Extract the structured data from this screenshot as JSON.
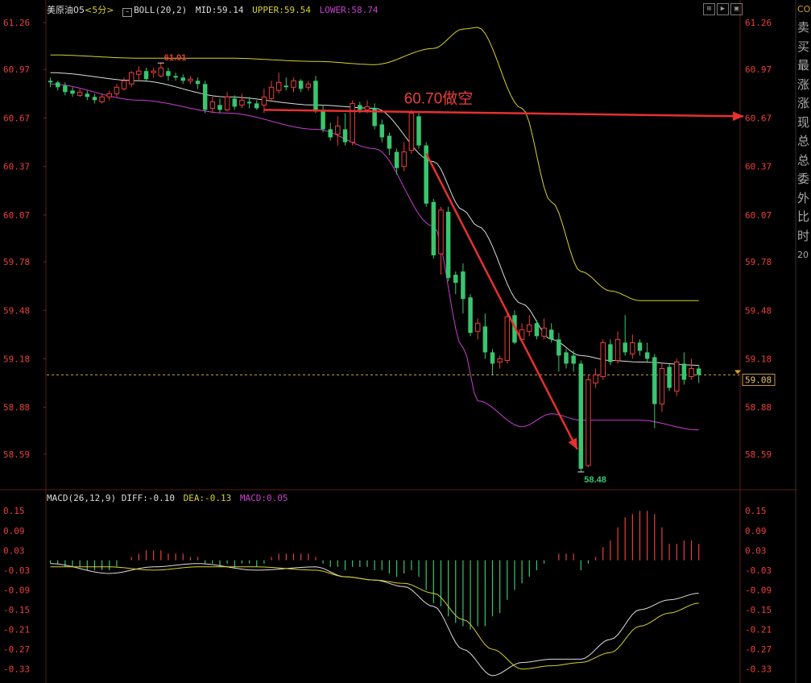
{
  "header": {
    "symbol": "美原油05",
    "period": "<5分>",
    "boll_label": "BOLL(20,2)",
    "mid_label": "MID:",
    "mid_value": "59.14",
    "upper_label": "UPPER:",
    "upper_value": "59.54",
    "lower_label": "LOWER:",
    "lower_value": "58.74"
  },
  "macd_header": {
    "label": "MACD(26,12,9)",
    "diff_label": "DIFF:",
    "diff_value": "-0.10",
    "dea_label": "DEA:",
    "dea_value": "-0.13",
    "macd_label": "MACD:",
    "macd_value": "0.05"
  },
  "side_panel": [
    "CO",
    "卖",
    "买",
    "最",
    "涨",
    "涨",
    "现",
    "总",
    "总",
    "委",
    "外",
    "比",
    "时",
    "20"
  ],
  "annotation_text": "60.70做空",
  "colors": {
    "up": "#e8403a",
    "down": "#39c66f",
    "mid": "#dddddd",
    "upper": "#d9d12c",
    "lower": "#c93fd2",
    "dea": "#d9d12c",
    "arrow": "#e83030",
    "axis_text": "#e8403a",
    "current_line": "#c89a3c"
  },
  "chart_data": [
    {
      "type": "candlestick",
      "title": "美原油05 <5分> BOLL(20,2)",
      "ylim": [
        58.42,
        61.3
      ],
      "y_ticks": [
        "61.26",
        "60.97",
        "60.67",
        "60.37",
        "60.07",
        "59.78",
        "59.48",
        "59.18",
        "58.88",
        "58.59"
      ],
      "y_tick_values": [
        61.26,
        60.97,
        60.67,
        60.37,
        60.07,
        59.78,
        59.48,
        59.18,
        58.88,
        58.59
      ],
      "current_price": 59.08,
      "current_price_label": "59.08",
      "high_label": "61.01",
      "high_value": 61.01,
      "low_label": "58.48",
      "low_value": 58.48,
      "bar_count": 84,
      "candles": [
        [
          0,
          60.9,
          60.89,
          60.92,
          60.86
        ],
        [
          1,
          60.89,
          60.86,
          60.9,
          60.84
        ],
        [
          2,
          60.87,
          60.83,
          60.89,
          60.81
        ],
        [
          3,
          60.84,
          60.82,
          60.86,
          60.8
        ],
        [
          4,
          60.81,
          60.83,
          60.85,
          60.8
        ],
        [
          5,
          60.82,
          60.8,
          60.84,
          60.78
        ],
        [
          6,
          60.8,
          60.78,
          60.82,
          60.76
        ],
        [
          7,
          60.77,
          60.8,
          60.82,
          60.76
        ],
        [
          8,
          60.8,
          60.82,
          60.84,
          60.78
        ],
        [
          9,
          60.82,
          60.86,
          60.88,
          60.8
        ],
        [
          10,
          60.85,
          60.9,
          60.92,
          60.84
        ],
        [
          11,
          60.88,
          60.95,
          60.96,
          60.86
        ],
        [
          12,
          60.94,
          60.96,
          60.99,
          60.9
        ],
        [
          13,
          60.96,
          60.91,
          60.98,
          60.9
        ],
        [
          14,
          60.95,
          60.96,
          60.98,
          60.92
        ],
        [
          15,
          60.93,
          60.98,
          61.01,
          60.92
        ],
        [
          16,
          60.96,
          60.93,
          60.98,
          60.9
        ],
        [
          17,
          60.93,
          60.92,
          60.95,
          60.9
        ],
        [
          18,
          60.92,
          60.9,
          60.94,
          60.88
        ],
        [
          19,
          60.9,
          60.91,
          60.93,
          60.88
        ],
        [
          20,
          60.9,
          60.88,
          60.92,
          60.85
        ],
        [
          21,
          60.88,
          60.72,
          60.9,
          60.7
        ],
        [
          22,
          60.73,
          60.77,
          60.8,
          60.7
        ],
        [
          23,
          60.75,
          60.72,
          60.79,
          60.7
        ],
        [
          24,
          60.72,
          60.8,
          60.83,
          60.71
        ],
        [
          25,
          60.79,
          60.74,
          60.81,
          60.72
        ],
        [
          26,
          60.75,
          60.78,
          60.82,
          60.73
        ],
        [
          27,
          60.77,
          60.76,
          60.8,
          60.73
        ],
        [
          28,
          60.76,
          60.73,
          60.78,
          60.72
        ],
        [
          29,
          60.75,
          60.8,
          60.85,
          60.7
        ],
        [
          30,
          60.79,
          60.86,
          60.9,
          60.78
        ],
        [
          31,
          60.84,
          60.89,
          60.95,
          60.82
        ],
        [
          32,
          60.87,
          60.86,
          60.92,
          60.84
        ],
        [
          33,
          60.86,
          60.9,
          60.92,
          60.83
        ],
        [
          34,
          60.9,
          60.85,
          60.91,
          60.83
        ],
        [
          35,
          60.86,
          60.88,
          60.9,
          60.84
        ],
        [
          36,
          60.9,
          60.72,
          60.93,
          60.7
        ],
        [
          37,
          60.72,
          60.6,
          60.75,
          60.58
        ],
        [
          38,
          60.6,
          60.55,
          60.64,
          60.53
        ],
        [
          39,
          60.57,
          60.62,
          60.68,
          60.5
        ],
        [
          40,
          60.6,
          60.52,
          60.7,
          60.5
        ],
        [
          41,
          60.52,
          60.76,
          60.78,
          60.5
        ],
        [
          42,
          60.75,
          60.72,
          60.77,
          60.7
        ],
        [
          43,
          60.72,
          60.74,
          60.78,
          60.7
        ],
        [
          44,
          60.73,
          60.62,
          60.76,
          60.6
        ],
        [
          45,
          60.63,
          60.55,
          60.66,
          60.52
        ],
        [
          46,
          60.56,
          60.48,
          60.58,
          60.44
        ],
        [
          47,
          60.46,
          60.36,
          60.48,
          60.32
        ],
        [
          48,
          60.37,
          60.46,
          60.52,
          60.34
        ],
        [
          49,
          60.47,
          60.7,
          60.72,
          60.45
        ],
        [
          50,
          60.68,
          60.5,
          60.7,
          60.48
        ],
        [
          51,
          60.5,
          60.14,
          60.52,
          60.12
        ],
        [
          52,
          60.15,
          59.82,
          60.17,
          59.8
        ],
        [
          53,
          59.83,
          60.1,
          60.12,
          59.7
        ],
        [
          54,
          60.09,
          59.68,
          60.12,
          59.66
        ],
        [
          55,
          59.7,
          59.65,
          59.72,
          59.58
        ],
        [
          56,
          59.72,
          59.55,
          59.77,
          59.46
        ],
        [
          57,
          59.56,
          59.34,
          59.58,
          59.32
        ],
        [
          58,
          59.35,
          59.4,
          59.43,
          59.3
        ],
        [
          59,
          59.38,
          59.22,
          59.46,
          59.18
        ],
        [
          60,
          59.22,
          59.15,
          59.24,
          59.08
        ],
        [
          61,
          59.16,
          59.18,
          59.2,
          59.12
        ],
        [
          62,
          59.17,
          59.44,
          59.47,
          59.15
        ],
        [
          63,
          59.45,
          59.28,
          59.48,
          59.27
        ],
        [
          64,
          59.3,
          59.36,
          59.4,
          59.28
        ],
        [
          65,
          59.35,
          59.39,
          59.45,
          59.32
        ],
        [
          66,
          59.4,
          59.32,
          59.42,
          59.3
        ],
        [
          67,
          59.32,
          59.37,
          59.43,
          59.3
        ],
        [
          68,
          59.36,
          59.3,
          59.4,
          59.28
        ],
        [
          69,
          59.3,
          59.2,
          59.34,
          59.1
        ],
        [
          70,
          59.22,
          59.15,
          59.24,
          59.12
        ],
        [
          71,
          59.2,
          59.15,
          59.23,
          59.1
        ],
        [
          72,
          59.15,
          58.5,
          59.17,
          58.48
        ],
        [
          73,
          58.52,
          59.05,
          59.08,
          58.51
        ],
        [
          74,
          59.03,
          59.08,
          59.12,
          59.0
        ],
        [
          75,
          59.07,
          59.28,
          59.3,
          59.05
        ],
        [
          76,
          59.27,
          59.16,
          59.3,
          59.14
        ],
        [
          77,
          59.17,
          59.3,
          59.35,
          59.15
        ],
        [
          78,
          59.28,
          59.22,
          59.45,
          59.2
        ],
        [
          79,
          59.21,
          59.28,
          59.33,
          59.18
        ],
        [
          80,
          59.28,
          59.23,
          59.3,
          59.2
        ],
        [
          81,
          59.22,
          59.18,
          59.28,
          59.16
        ],
        [
          82,
          59.19,
          58.9,
          59.21,
          58.75
        ],
        [
          83,
          58.9,
          59.12,
          59.15,
          58.85
        ],
        [
          84,
          59.13,
          59.0,
          59.15,
          58.98
        ],
        [
          85,
          58.98,
          59.16,
          59.18,
          58.95
        ],
        [
          86,
          59.15,
          59.05,
          59.22,
          59.02
        ],
        [
          87,
          59.07,
          59.12,
          59.18,
          59.05
        ],
        [
          88,
          59.12,
          59.08,
          59.14,
          59.03
        ]
      ],
      "series": [
        {
          "key": "upper",
          "x": [
            0,
            12,
            24,
            36,
            44,
            52,
            56,
            58,
            64,
            68,
            72,
            76,
            80,
            88
          ],
          "y": [
            61.06,
            61.04,
            61.04,
            61.02,
            61.0,
            61.1,
            61.22,
            61.23,
            60.73,
            60.15,
            59.72,
            59.6,
            59.54,
            59.54
          ]
        },
        {
          "key": "mid",
          "x": [
            0,
            12,
            24,
            36,
            44,
            52,
            56,
            58,
            64,
            68,
            72,
            76,
            80,
            88
          ],
          "y": [
            60.95,
            60.9,
            60.8,
            60.75,
            60.73,
            60.4,
            60.1,
            60.0,
            59.52,
            59.3,
            59.2,
            59.17,
            59.16,
            59.14
          ]
        },
        {
          "key": "lower",
          "x": [
            0,
            12,
            24,
            36,
            44,
            52,
            56,
            58,
            64,
            68,
            72,
            76,
            80,
            88
          ],
          "y": [
            60.88,
            60.78,
            60.7,
            60.6,
            60.48,
            60.0,
            59.25,
            58.92,
            58.76,
            58.84,
            58.8,
            58.8,
            58.8,
            58.74
          ]
        }
      ],
      "arrows": [
        {
          "from": [
            29,
            60.72
          ],
          "to": [
            96,
            60.68
          ]
        },
        {
          "from": [
            51,
            60.45
          ],
          "to": [
            71.5,
            58.62
          ]
        }
      ],
      "annotation_anchor": [
        48,
        60.76
      ]
    },
    {
      "type": "macd",
      "title": "MACD(26,12,9)",
      "ylim": [
        -0.36,
        0.175
      ],
      "y_ticks": [
        "0.15",
        "0.09",
        "0.03",
        "-0.03",
        "-0.09",
        "-0.15",
        "-0.21",
        "-0.27",
        "-0.33"
      ],
      "y_tick_values": [
        0.15,
        0.09,
        0.03,
        -0.03,
        -0.09,
        -0.15,
        -0.21,
        -0.27,
        -0.33
      ],
      "macd": [
        -0.01,
        -0.01,
        -0.02,
        -0.02,
        -0.02,
        -0.03,
        -0.03,
        -0.03,
        -0.03,
        -0.02,
        0.0,
        0.01,
        0.02,
        0.03,
        0.03,
        0.03,
        0.02,
        0.02,
        0.02,
        0.01,
        0.01,
        -0.01,
        -0.01,
        -0.02,
        -0.01,
        -0.02,
        -0.01,
        -0.01,
        -0.02,
        -0.01,
        0.01,
        0.02,
        0.02,
        0.02,
        0.02,
        0.02,
        0.01,
        -0.01,
        -0.02,
        -0.02,
        -0.03,
        -0.02,
        -0.02,
        -0.02,
        -0.03,
        -0.03,
        -0.04,
        -0.05,
        -0.04,
        -0.03,
        -0.05,
        -0.09,
        -0.13,
        -0.14,
        -0.17,
        -0.19,
        -0.2,
        -0.21,
        -0.2,
        -0.2,
        -0.17,
        -0.16,
        -0.12,
        -0.09,
        -0.07,
        -0.05,
        -0.03,
        -0.01,
        0.0,
        0.02,
        0.02,
        0.02,
        -0.03,
        -0.01,
        0.01,
        0.04,
        0.06,
        0.1,
        0.13,
        0.14,
        0.15,
        0.15,
        0.14,
        0.1,
        0.05,
        0.05,
        0.06,
        0.06,
        0.05
      ],
      "series": [
        {
          "key": "diff",
          "x": [
            0,
            8,
            14,
            20,
            28,
            36,
            40,
            44,
            48,
            52,
            56,
            60,
            64,
            68,
            72,
            76,
            80,
            84,
            88
          ],
          "y": [
            -0.01,
            -0.04,
            -0.02,
            -0.01,
            -0.03,
            -0.02,
            -0.05,
            -0.06,
            -0.08,
            -0.14,
            -0.27,
            -0.35,
            -0.31,
            -0.3,
            -0.3,
            -0.24,
            -0.15,
            -0.12,
            -0.1
          ]
        },
        {
          "key": "dea",
          "x": [
            0,
            8,
            14,
            20,
            28,
            36,
            40,
            44,
            48,
            52,
            56,
            60,
            64,
            68,
            72,
            76,
            80,
            84,
            88
          ],
          "y": [
            -0.02,
            -0.02,
            -0.03,
            -0.02,
            -0.02,
            -0.03,
            -0.05,
            -0.06,
            -0.07,
            -0.1,
            -0.18,
            -0.27,
            -0.33,
            -0.32,
            -0.31,
            -0.28,
            -0.2,
            -0.16,
            -0.13
          ]
        }
      ]
    }
  ]
}
